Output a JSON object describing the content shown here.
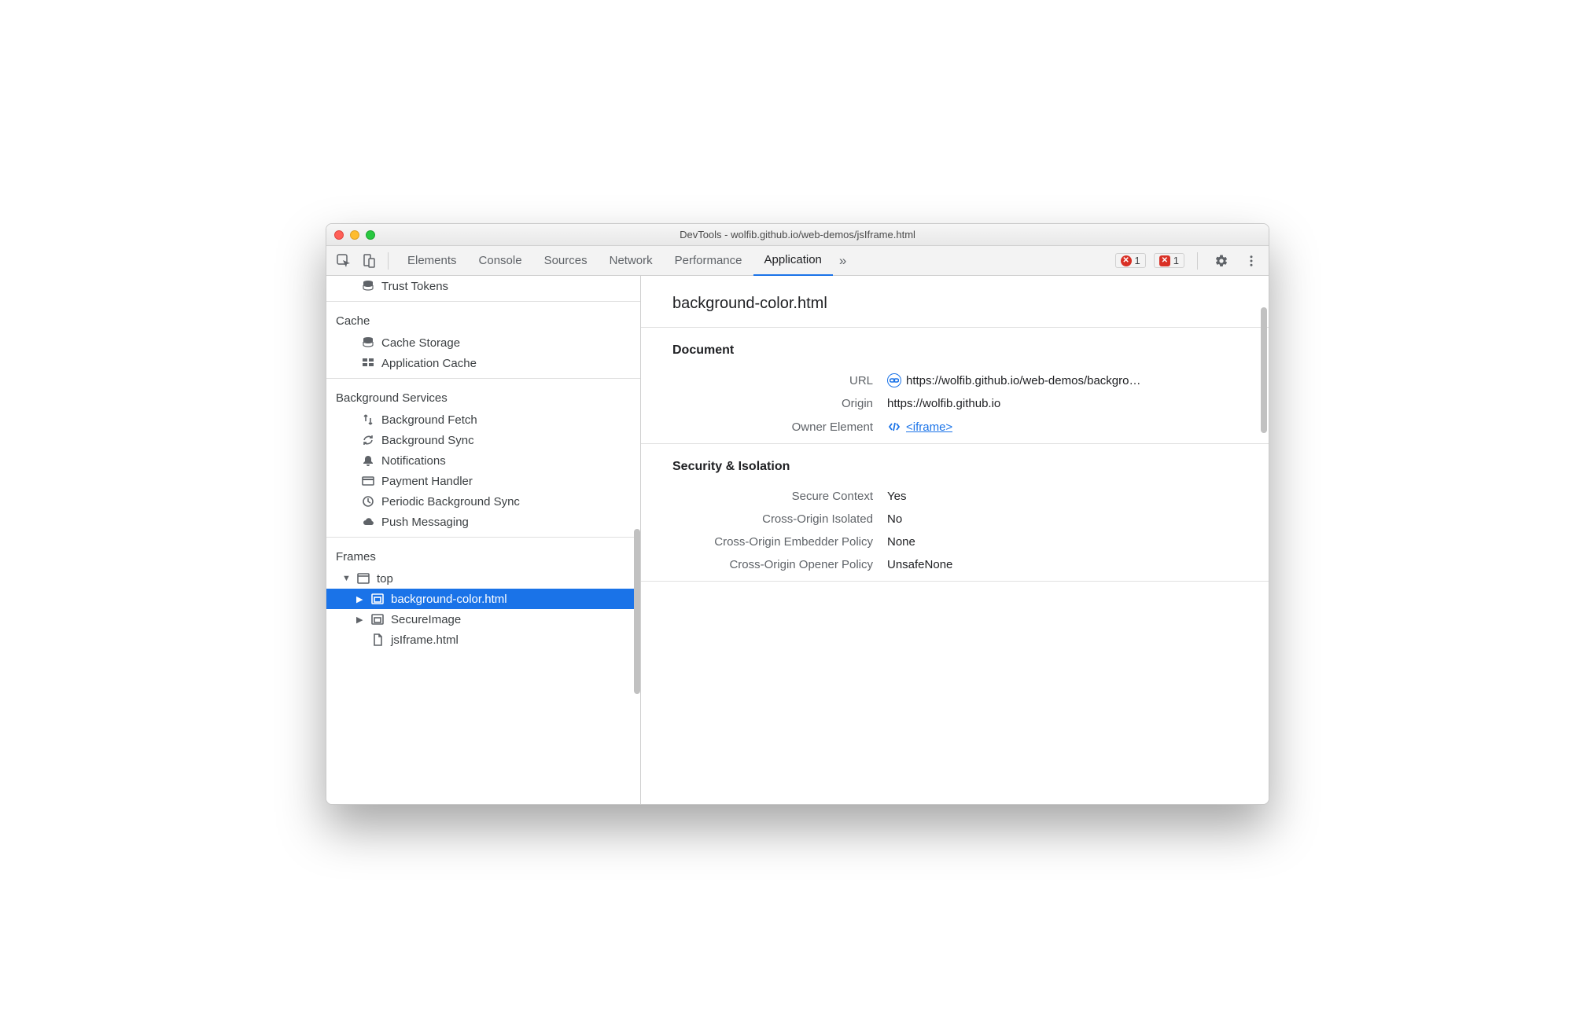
{
  "window": {
    "title": "DevTools - wolfib.github.io/web-demos/jsIframe.html"
  },
  "tabbar": {
    "tabs": [
      "Elements",
      "Console",
      "Sources",
      "Network",
      "Performance",
      "Application"
    ],
    "active_index": 5,
    "overflow_glyph": "»",
    "error_count": "1",
    "issue_count": "1"
  },
  "sidebar": {
    "items": [
      {
        "icon": "database-icon",
        "label": "Trust Tokens",
        "indent": 1
      }
    ],
    "cache_header": "Cache",
    "cache_items": [
      {
        "icon": "database-icon",
        "label": "Cache Storage"
      },
      {
        "icon": "grid-icon",
        "label": "Application Cache"
      }
    ],
    "bg_header": "Background Services",
    "bg_items": [
      {
        "icon": "fetch-icon",
        "label": "Background Fetch"
      },
      {
        "icon": "sync-icon",
        "label": "Background Sync"
      },
      {
        "icon": "bell-icon",
        "label": "Notifications"
      },
      {
        "icon": "card-icon",
        "label": "Payment Handler"
      },
      {
        "icon": "clock-icon",
        "label": "Periodic Background Sync"
      },
      {
        "icon": "cloud-icon",
        "label": "Push Messaging"
      }
    ],
    "frames_header": "Frames",
    "frames": {
      "top_label": "top",
      "children": [
        {
          "label": "background-color.html",
          "selected": true,
          "hasChildren": true
        },
        {
          "label": "SecureImage",
          "selected": false,
          "hasChildren": true
        },
        {
          "label": "jsIframe.html",
          "selected": false,
          "hasChildren": false,
          "fileIcon": true
        }
      ]
    }
  },
  "main": {
    "title": "background-color.html",
    "document_header": "Document",
    "url_key": "URL",
    "url_value": "https://wolfib.github.io/web-demos/backgro…",
    "origin_key": "Origin",
    "origin_value": "https://wolfib.github.io",
    "owner_key": "Owner Element",
    "owner_value": "<iframe>",
    "security_header": "Security & Isolation",
    "secure_key": "Secure Context",
    "secure_value": "Yes",
    "coi_key": "Cross-Origin Isolated",
    "coi_value": "No",
    "coep_key": "Cross-Origin Embedder Policy",
    "coep_value": "None",
    "coop_key": "Cross-Origin Opener Policy",
    "coop_value": "UnsafeNone"
  }
}
